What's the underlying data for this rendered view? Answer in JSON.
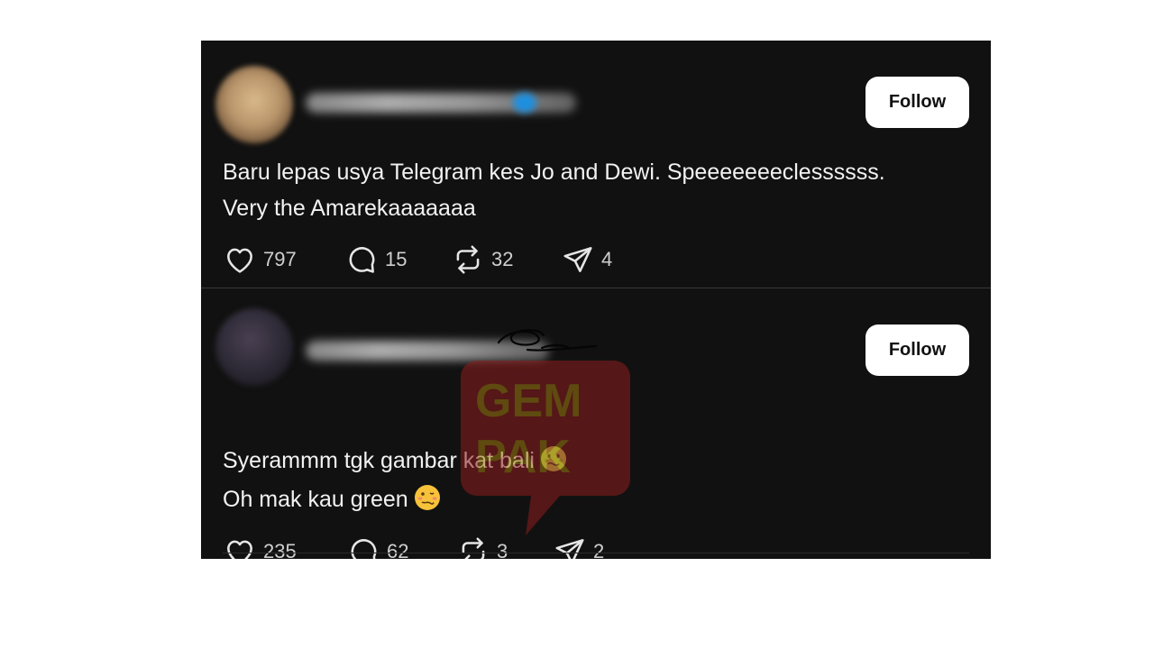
{
  "posts": [
    {
      "follow_label": "Follow",
      "text_lines": [
        "Baru lepas usya Telegram kes Jo and Dewi. Speeeeeeeclessssss.",
        "Very the Amarekaaaaaaa"
      ],
      "likes": "797",
      "comments": "15",
      "reposts": "32",
      "shares": "4"
    },
    {
      "follow_label": "Follow",
      "text_lines": [
        "Syerammm tgk gambar kat bali",
        "Oh mak kau green"
      ],
      "emojis": [
        "nauseated-face-emoji",
        "woozy-face-emoji"
      ],
      "likes": "235",
      "comments": "62",
      "reposts": "3",
      "shares": "2"
    }
  ],
  "watermark": {
    "line1": "GEM",
    "line2": "PAK"
  },
  "colors": {
    "background": "#111111",
    "text": "#f2f2f2",
    "count_text": "#cfcfcf",
    "follow_bg": "#ffffff",
    "watermark": "#9b1c1c"
  },
  "icons": [
    "heart-icon",
    "comment-icon",
    "repost-icon",
    "share-icon"
  ]
}
